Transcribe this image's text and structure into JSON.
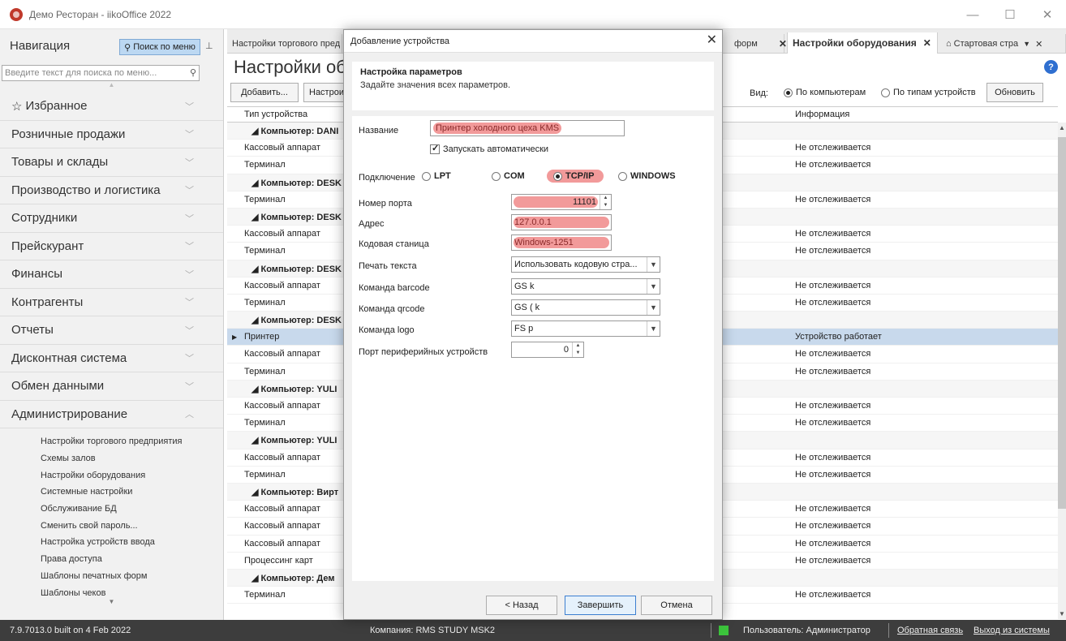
{
  "window": {
    "title": "Демо Ресторан - iikoOffice 2022",
    "controls": [
      "—",
      "☐",
      "✕"
    ]
  },
  "nav": {
    "title": "Навигация",
    "search_button": "Поиск по меню",
    "search_placeholder": "Введите текст для поиска по меню...",
    "groups": [
      {
        "label": "Избранное",
        "chevron": "﹀"
      },
      {
        "label": "Розничные продажи",
        "chevron": "﹀"
      },
      {
        "label": "Товары и склады",
        "chevron": "﹀"
      },
      {
        "label": "Производство и логистика",
        "chevron": "﹀"
      },
      {
        "label": "Сотрудники",
        "chevron": "﹀"
      },
      {
        "label": "Прейскурант",
        "chevron": "﹀"
      },
      {
        "label": "Финансы",
        "chevron": "﹀"
      },
      {
        "label": "Контрагенты",
        "chevron": "﹀"
      },
      {
        "label": "Отчеты",
        "chevron": "﹀"
      },
      {
        "label": "Дисконтная система",
        "chevron": "﹀"
      },
      {
        "label": "Обмен данными",
        "chevron": "﹀"
      },
      {
        "label": "Администрирование",
        "chevron": "︿"
      }
    ],
    "admin_items": [
      "Настройки торгового предприятия",
      "Схемы залов",
      "Настройки оборудования",
      "Системные настройки",
      "Обслуживание БД",
      "Сменить свой пароль...",
      "Настройка устройств ввода",
      "Права доступа",
      "Шаблоны печатных форм",
      "Шаблоны чеков"
    ]
  },
  "tabs": {
    "tab1": "Настройки торгового пред",
    "tab2": "форм",
    "tab3": "Настройки оборудования",
    "tab4": "Стартовая стра",
    "close": "✕"
  },
  "main": {
    "title": "Настройки об",
    "add_button": "Добавить...",
    "settings_button": "Настрои",
    "view_label": "Вид:",
    "view_by_computer": "По компьютерам",
    "view_by_type": "По типам устройств",
    "refresh_button": "Обновить",
    "col_type": "Тип устройства",
    "col_info": "Информация",
    "rows": [
      {
        "kind": "group",
        "type": "◢  Компьютер: DANI",
        "info": ""
      },
      {
        "kind": "item",
        "type": "Кассовый аппарат",
        "info": "Не отслеживается"
      },
      {
        "kind": "item",
        "type": "Терминал",
        "info": "Не отслеживается"
      },
      {
        "kind": "group",
        "type": "◢  Компьютер: DESK",
        "info": ""
      },
      {
        "kind": "item",
        "type": "Терминал",
        "info": "Не отслеживается"
      },
      {
        "kind": "group",
        "type": "◢  Компьютер: DESK",
        "info": ""
      },
      {
        "kind": "item",
        "type": "Кассовый аппарат",
        "info": "Не отслеживается"
      },
      {
        "kind": "item",
        "type": "Терминал",
        "info": "Не отслеживается"
      },
      {
        "kind": "group",
        "type": "◢  Компьютер: DESK",
        "info": ""
      },
      {
        "kind": "item",
        "type": "Кассовый аппарат",
        "info": "Не отслеживается"
      },
      {
        "kind": "item",
        "type": "Терминал",
        "info": "Не отслеживается"
      },
      {
        "kind": "group",
        "type": "◢  Компьютер: DESK",
        "info": ""
      },
      {
        "kind": "sel",
        "type": "Принтер",
        "info": "Устройство работает"
      },
      {
        "kind": "item",
        "type": "Кассовый аппарат",
        "info": "Не отслеживается"
      },
      {
        "kind": "item",
        "type": "Терминал",
        "info": "Не отслеживается"
      },
      {
        "kind": "group",
        "type": "◢  Компьютер: YULI",
        "info": ""
      },
      {
        "kind": "item",
        "type": "Кассовый аппарат",
        "info": "Не отслеживается"
      },
      {
        "kind": "item",
        "type": "Терминал",
        "info": "Не отслеживается"
      },
      {
        "kind": "group",
        "type": "◢  Компьютер: YULI",
        "info": ""
      },
      {
        "kind": "item",
        "type": "Кассовый аппарат",
        "info": "Не отслеживается"
      },
      {
        "kind": "item",
        "type": "Терминал",
        "info": "Не отслеживается"
      },
      {
        "kind": "group",
        "type": "◢  Компьютер: Вирт",
        "info": ""
      },
      {
        "kind": "item",
        "type": "Кассовый аппарат",
        "info": "Не отслеживается"
      },
      {
        "kind": "item",
        "type": "Кассовый аппарат",
        "info": "Не отслеживается"
      },
      {
        "kind": "item",
        "type": "Кассовый аппарат",
        "info": "Не отслеживается"
      },
      {
        "kind": "item",
        "type": "Процессинг карт",
        "info": "Не отслеживается"
      },
      {
        "kind": "group",
        "type": "◢  Компьютер: Дем",
        "info": ""
      },
      {
        "kind": "item",
        "type": "Терминал",
        "info": "Не отслеживается"
      }
    ]
  },
  "dialog": {
    "title": "Добавление устройства",
    "header_title": "Настройка параметров",
    "header_subtitle": "Задайте значения всех параметров.",
    "name_label": "Название",
    "name_value": "Принтер холодного цеха KMS",
    "autostart_label": "Запускать автоматически",
    "connection_label": "Подключение",
    "conn_lpt": "LPT",
    "conn_com": "COM",
    "conn_tcp": "TCP/IP",
    "conn_windows": "WINDOWS",
    "port_label": "Номер порта",
    "port_value": "11101",
    "address_label": "Адрес",
    "address_value": "127.0.0.1",
    "codepage_label": "Кодовая станица",
    "codepage_value": "Windows-1251",
    "print_text_label": "Печать текста",
    "print_text_value": "Использовать кодовую стра...",
    "barcode_label": "Команда barcode",
    "barcode_value": "GS k",
    "qrcode_label": "Команда qrcode",
    "qrcode_value": "GS ( k",
    "logo_label": "Команда logo",
    "logo_value": "FS p",
    "periph_label": "Порт периферийных устройств",
    "periph_value": "0",
    "back_button": "< Назад",
    "finish_button": "Завершить",
    "cancel_button": "Отмена"
  },
  "status": {
    "version": "7.9.7013.0 built on 4 Feb 2022",
    "company": "Компания: RMS STUDY MSK2",
    "user": "Пользователь: Администратор",
    "feedback": "Обратная связь",
    "logout": "Выход из системы"
  },
  "colors": {
    "highlight": "#f29a9a",
    "selected_row": "#c8d9ec",
    "statusbar": "#3d3d3d",
    "status_ok": "#3cc43c"
  }
}
